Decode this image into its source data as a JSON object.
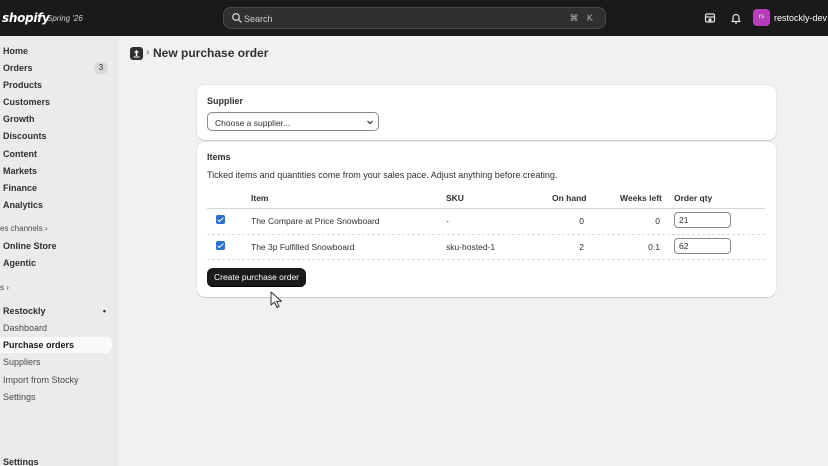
{
  "topbar": {
    "logo": "shopify",
    "edition": "Spring '26",
    "search_placeholder": "Search",
    "search_shortcut": "⌘ K",
    "account_initials": "rs",
    "account_name": "restockly-dev"
  },
  "sidebar": {
    "items": [
      {
        "label": "Home"
      },
      {
        "label": "Orders",
        "badge": "3"
      },
      {
        "label": "Products"
      },
      {
        "label": "Customers"
      },
      {
        "label": "Growth"
      },
      {
        "label": "Discounts"
      },
      {
        "label": "Content"
      },
      {
        "label": "Markets"
      },
      {
        "label": "Finance"
      },
      {
        "label": "Analytics"
      }
    ],
    "sales_channels_heading": "es channels ›",
    "channels": [
      {
        "label": "Online Store"
      },
      {
        "label": "Agentic"
      }
    ],
    "apps_heading": "s ›",
    "app_name": "Restockly",
    "app_dot": "•",
    "app_items": [
      {
        "label": "Dashboard"
      },
      {
        "label": "Purchase orders"
      },
      {
        "label": "Suppliers"
      },
      {
        "label": "Import from Stocky"
      },
      {
        "label": "Settings"
      }
    ],
    "footer_settings": "Settings"
  },
  "page": {
    "breadcrumb_sep": "›",
    "title": "New purchase order"
  },
  "supplier_card": {
    "title": "Supplier",
    "select_value": "Choose a supplier..."
  },
  "items_card": {
    "title": "Items",
    "description": "Ticked items and quantities come from your sales pace. Adjust anything before creating.",
    "columns": [
      "Item",
      "SKU",
      "On hand",
      "Weeks left",
      "Order qty"
    ],
    "rows": [
      {
        "checked": true,
        "item": "The Compare at Price Snowboard",
        "sku": "-",
        "on_hand": "0",
        "weeks_left": "0",
        "order_qty": "21"
      },
      {
        "checked": true,
        "item": "The 3p Fulfilled Snowboard",
        "sku": "sku-hosted-1",
        "on_hand": "2",
        "weeks_left": "0.1",
        "order_qty": "62"
      }
    ],
    "create_button": "Create purchase order"
  },
  "colors": {
    "topbar": "#1a1a1a",
    "checkbox": "#2c6ecb",
    "primary_button": "#1a1a1a",
    "avatar": "#b43fb8"
  }
}
